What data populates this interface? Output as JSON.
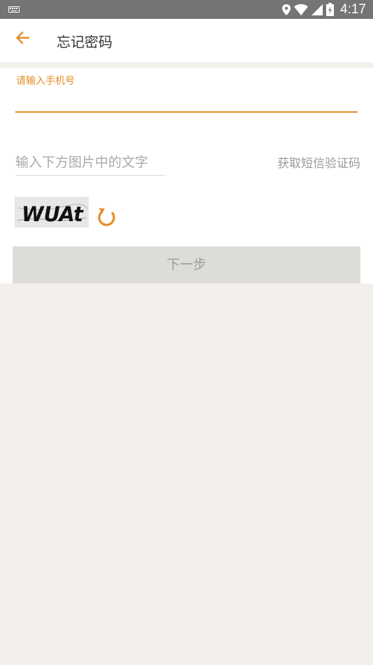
{
  "status_bar": {
    "time": "4:17",
    "icons": [
      "keyboard-icon",
      "location-icon",
      "wifi-icon",
      "signal-icon",
      "battery-charging-icon"
    ]
  },
  "app_bar": {
    "title": "忘记密码",
    "back_icon": "arrow-left-icon"
  },
  "form": {
    "phone_label": "请输入手机号",
    "phone_value": "",
    "captcha_placeholder": "输入下方图片中的文字",
    "captcha_value": "",
    "sms_link_label": "获取短信验证码",
    "captcha_image_text": "WUAt",
    "refresh_icon": "refresh-icon",
    "next_button_label": "下一步"
  },
  "colors": {
    "accent": "#e48d25",
    "status_bar": "#757575",
    "page_background": "#f3f0eb",
    "button_disabled": "#dedcd8",
    "button_text_disabled": "#9b9b9b"
  }
}
